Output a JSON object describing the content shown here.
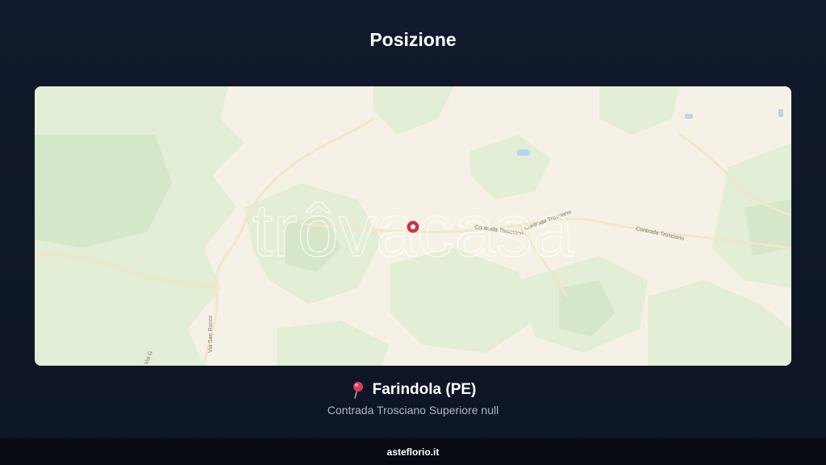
{
  "page": {
    "title": "Posizione"
  },
  "map": {
    "watermark": "trôvacasa",
    "road_labels": [
      "Contrada Trosciano",
      "Contrada Trosciano",
      "Contrada Trosciano",
      "Via San Rocco",
      "Via G"
    ],
    "marker_icon": "map-marker-icon",
    "colors": {
      "land": "#f6f1e6",
      "forest": "#e2eed6",
      "road": "#f3e6c6",
      "water": "#b6d6ea",
      "marker": "#d0333f"
    }
  },
  "location": {
    "pin_icon": "round-pushpin-icon",
    "city": "Farindola (PE)",
    "address": "Contrada Trosciano Superiore null"
  },
  "footer": {
    "brand": "asteflorio.it"
  }
}
